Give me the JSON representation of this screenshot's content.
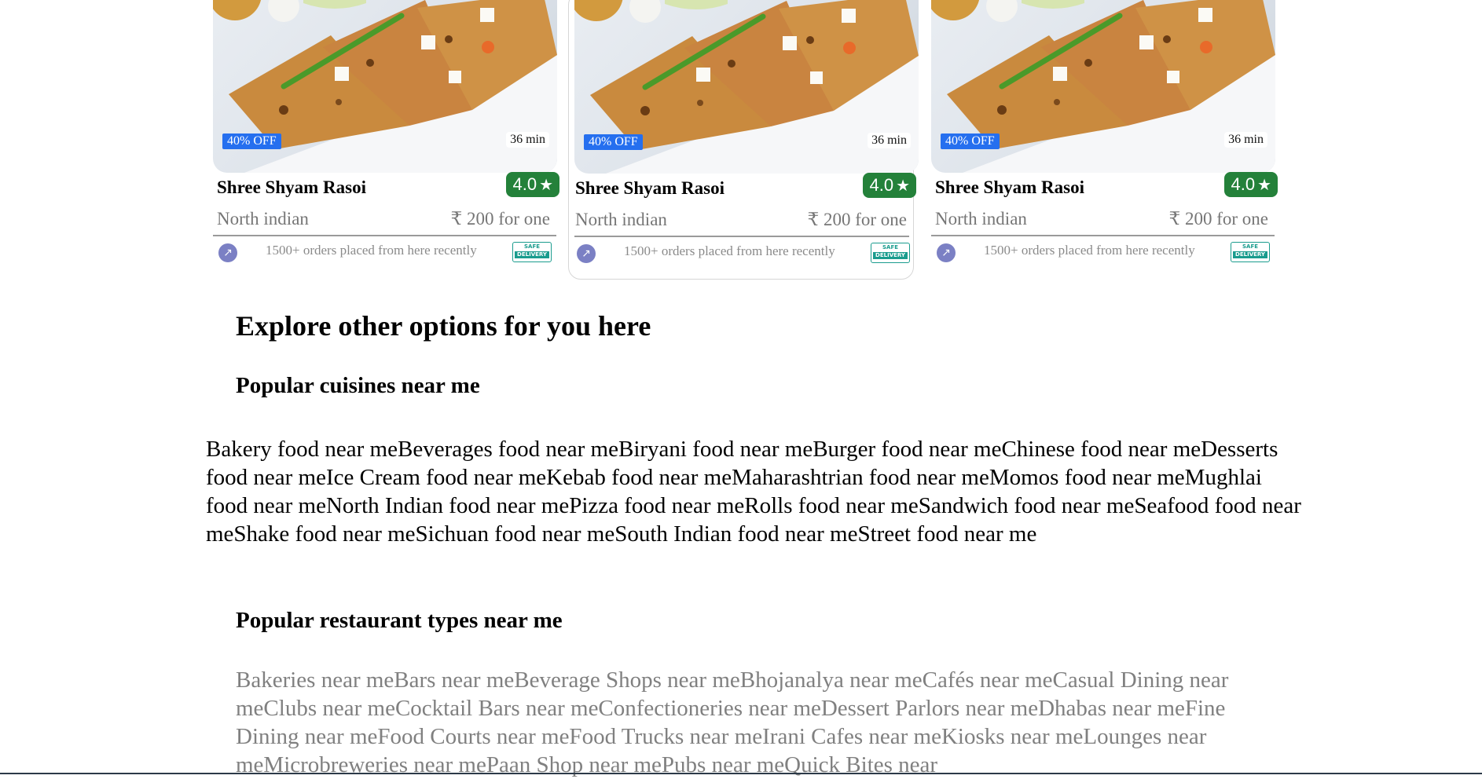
{
  "cards": [
    {
      "discount": "40% OFF",
      "delivery_time": "36 min",
      "name": "Shree Shyam Rasoi",
      "rating": "4.0",
      "cuisine": "North indian",
      "price": "₹ 200 for one",
      "orders_text": "1500+ orders placed from here recently",
      "safe_badge_line1": "SAFE",
      "safe_badge_line2": "DELIVERY"
    },
    {
      "discount": "40% OFF",
      "delivery_time": "36 min",
      "name": "Shree Shyam Rasoi",
      "rating": "4.0",
      "cuisine": "North indian",
      "price": "₹ 200 for one",
      "orders_text": "1500+ orders placed from here recently",
      "safe_badge_line1": "SAFE",
      "safe_badge_line2": "DELIVERY"
    },
    {
      "discount": "40% OFF",
      "delivery_time": "36 min",
      "name": "Shree Shyam Rasoi",
      "rating": "4.0",
      "cuisine": "North indian",
      "price": "₹ 200 for one",
      "orders_text": "1500+ orders placed from here recently",
      "safe_badge_line1": "SAFE",
      "safe_badge_line2": "DELIVERY"
    }
  ],
  "icons": {
    "rating_star": "star-icon",
    "trend": "trending-up-icon",
    "safe_delivery": "safe-delivery-badge-icon"
  },
  "colors": {
    "discount_badge": "#256fef",
    "rating_badge": "#24813a",
    "trend_icon": "#7b80c4",
    "safe_badge": "#1a9c8e",
    "muted_text": "#767676"
  },
  "explore": {
    "heading": "Explore other options for you here",
    "cuisines_heading": "Popular cuisines near me",
    "cuisines_text": "Bakery food near meBeverages food near meBiryani food near meBurger food near meChinese food near meDesserts food near meIce Cream food near meKebab food near meMaharashtrian food near meMomos food near meMughlai food near meNorth Indian food near mePizza food near meRolls food near meSandwich food near meSeafood food near meShake food near meSichuan food near meSouth Indian food near meStreet food near me",
    "types_heading": "Popular restaurant types near me",
    "types_text": "Bakeries near meBars near meBeverage Shops near meBhojanalya near meCafés near meCasual Dining near meClubs near meCocktail Bars near meConfectioneries near meDessert Parlors near meDhabas near meFine Dining near meFood Courts near meFood Trucks near meIrani Cafes near meKiosks near meLounges near meMicrobreweries near mePaan Shop near mePubs near meQuick Bites near"
  }
}
